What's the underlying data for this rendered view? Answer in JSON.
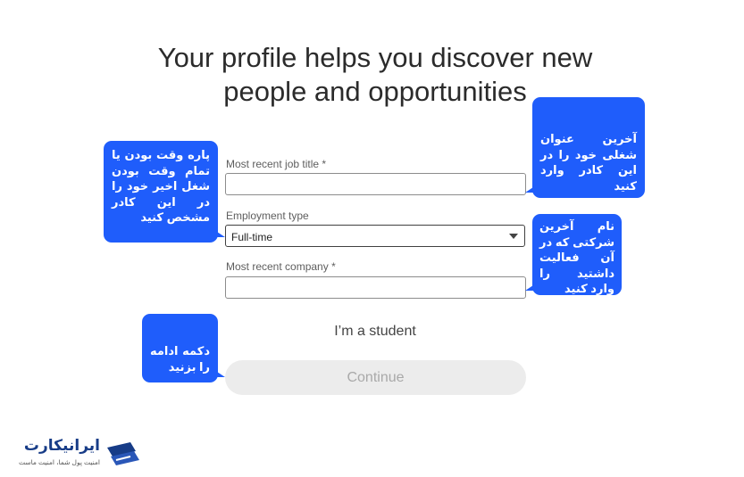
{
  "headline": {
    "line1": "Your profile helps you discover new",
    "line2": "people and opportunities"
  },
  "form": {
    "job_title": {
      "label": "Most recent job title",
      "required_mark": "*",
      "value": ""
    },
    "employment_type": {
      "label": "Employment type",
      "selected": "Full-time"
    },
    "company": {
      "label": "Most recent company",
      "required_mark": "*",
      "value": ""
    },
    "student_link": "I’m a student",
    "continue_label": "Continue"
  },
  "annotations": {
    "employment_type": "پاره وقت بودن یا تمام وقت بودن شغل اخیر خود را در این کادر مشخص کنید",
    "job_title": "آخرین عنوان شغلی خود را در این کادر وارد کنید",
    "company": "نام آخرین شرکتی که در آن فعالیت داشتید را وارد کنید",
    "continue": "دکمه ادامه را بزنید"
  },
  "brand": {
    "name": "ایرانیکارت",
    "tagline": "امنیت پول شما، امنیت ماست",
    "icon": "iranicard-logo-icon",
    "color": "#173c87"
  },
  "colors": {
    "bubble": "#1f5dfb",
    "continue_bg": "#ececec",
    "continue_text": "#a9a9a9"
  }
}
